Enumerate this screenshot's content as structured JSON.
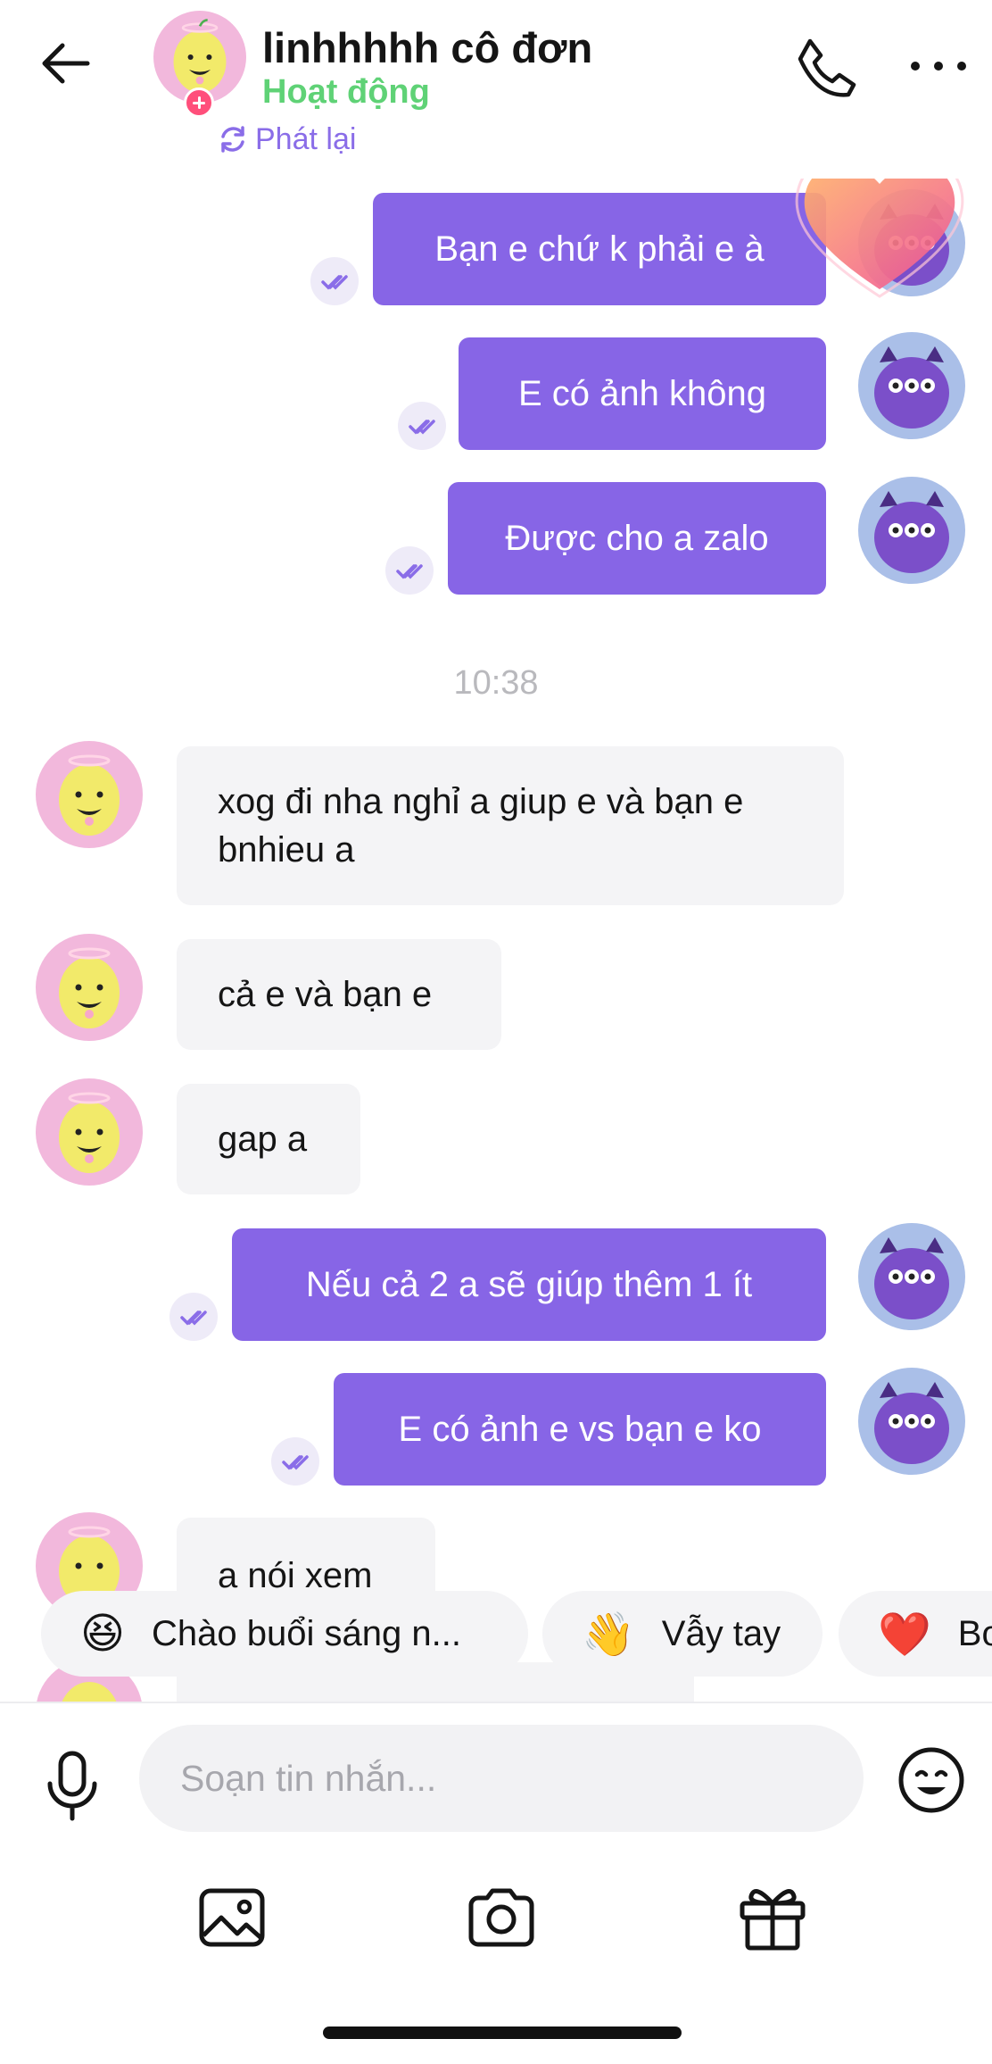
{
  "header": {
    "contact_name": "linhhhhh cô đơn",
    "status": "Hoạt động",
    "replay_label": "Phát lại",
    "colors": {
      "status": "#5fd276",
      "accent": "#8a6de8"
    }
  },
  "messages": {
    "outgoing_top": [
      {
        "text": "Bạn e chứ k phải e à"
      },
      {
        "text": "E có ảnh không"
      },
      {
        "text": "Được cho a zalo"
      }
    ],
    "timestamp": "10:38",
    "incoming": [
      {
        "text": "xog đi nha nghỉ a giup e và bạn e bnhieu a"
      },
      {
        "text": "cả e và bạn e"
      },
      {
        "text": "gap a"
      }
    ],
    "outgoing_bottom": [
      {
        "text": "Nếu cả 2 a sẽ giúp thêm 1 ít"
      },
      {
        "text": "E có ảnh e vs bạn e ko"
      }
    ],
    "incoming_last": {
      "text": "a nói xem"
    },
    "colors": {
      "outgoing_bubble": "#8765e6",
      "incoming_bubble": "#f4f4f6"
    }
  },
  "quick_replies": [
    {
      "icon": "sun-emoji",
      "emoji": "😆",
      "label": "Chào buổi sáng n..."
    },
    {
      "icon": "wave-emoji",
      "emoji": "👋",
      "label": "Vẫy tay"
    },
    {
      "icon": "heart-emoji",
      "emoji": "❤️",
      "label": "Bo"
    }
  ],
  "composer": {
    "placeholder": "Soạn tin nhắn...",
    "tools": [
      "image-icon",
      "camera-icon",
      "gift-icon"
    ]
  }
}
